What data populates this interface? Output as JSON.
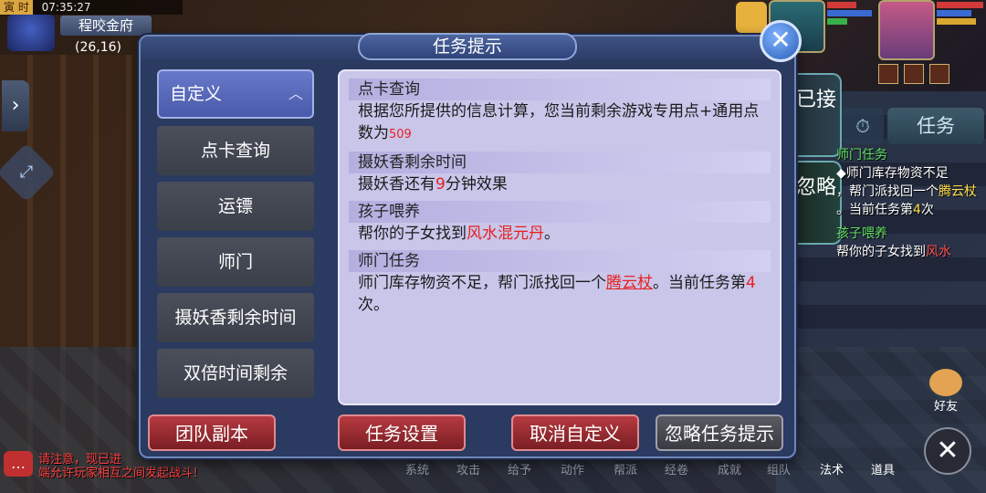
{
  "hud": {
    "season": "寅 时",
    "time": "07:35:27",
    "location": "程咬金府",
    "coords": "(26,16)"
  },
  "dialog": {
    "title": "任务提示",
    "close_icon": "close-icon",
    "list_header": "自定义",
    "list_items": [
      "点卡查询",
      "运镖",
      "师门",
      "摄妖香剩余时间",
      "双倍时间剩余"
    ],
    "sections": [
      {
        "title": "点卡查询",
        "body_prefix": "根据您所提供的信息计算，您当前剩余游戏专用点+通用点数为",
        "value": "509"
      },
      {
        "title": "摄妖香剩余时间",
        "body_prefix": "摄妖香还有",
        "value": "9",
        "body_suffix": "分钟效果"
      },
      {
        "title": "孩子喂养",
        "body_prefix": "帮你的子女找到",
        "value": "风水混元丹",
        "body_suffix": "。"
      },
      {
        "title": "师门任务",
        "body_prefix": "师门库存物资不足，帮门派找回一个",
        "value": "腾云杖",
        "body_mid": "。当前任务第",
        "count": "4",
        "body_suffix": "次。"
      }
    ],
    "buttons": {
      "team_dungeon": "团队副本",
      "task_settings": "任务设置",
      "cancel_custom": "取消自定义",
      "ignore_tips": "忽略任务提示"
    }
  },
  "side_tabs": {
    "accepted": "已接",
    "ignore": "忽略",
    "task": "任务"
  },
  "side_tracker": {
    "title": "师门任务",
    "line1": "◆师门库存物资不足",
    "line2_prefix": "，帮门派找回一个",
    "item": "腾云杖",
    "line3": "。当前任务第",
    "count": "4",
    "suffix": "次",
    "child_title": "孩子喂养",
    "child_prefix": "帮你的子女找到",
    "child_item": "风水"
  },
  "bottom_bar": [
    "系统",
    "攻击",
    "给予",
    "动作",
    "帮派",
    "经卷",
    "成就",
    "组队",
    "法术",
    "道具"
  ],
  "friend_label": "好友",
  "chat_lines": [
    "请注意，现已进",
    "端允许玩家相互之间发起战斗！"
  ],
  "colors": {
    "panel": "#c9c6ea",
    "highlight_red": "#e82020",
    "dialog_bg": "#2a3a60"
  }
}
